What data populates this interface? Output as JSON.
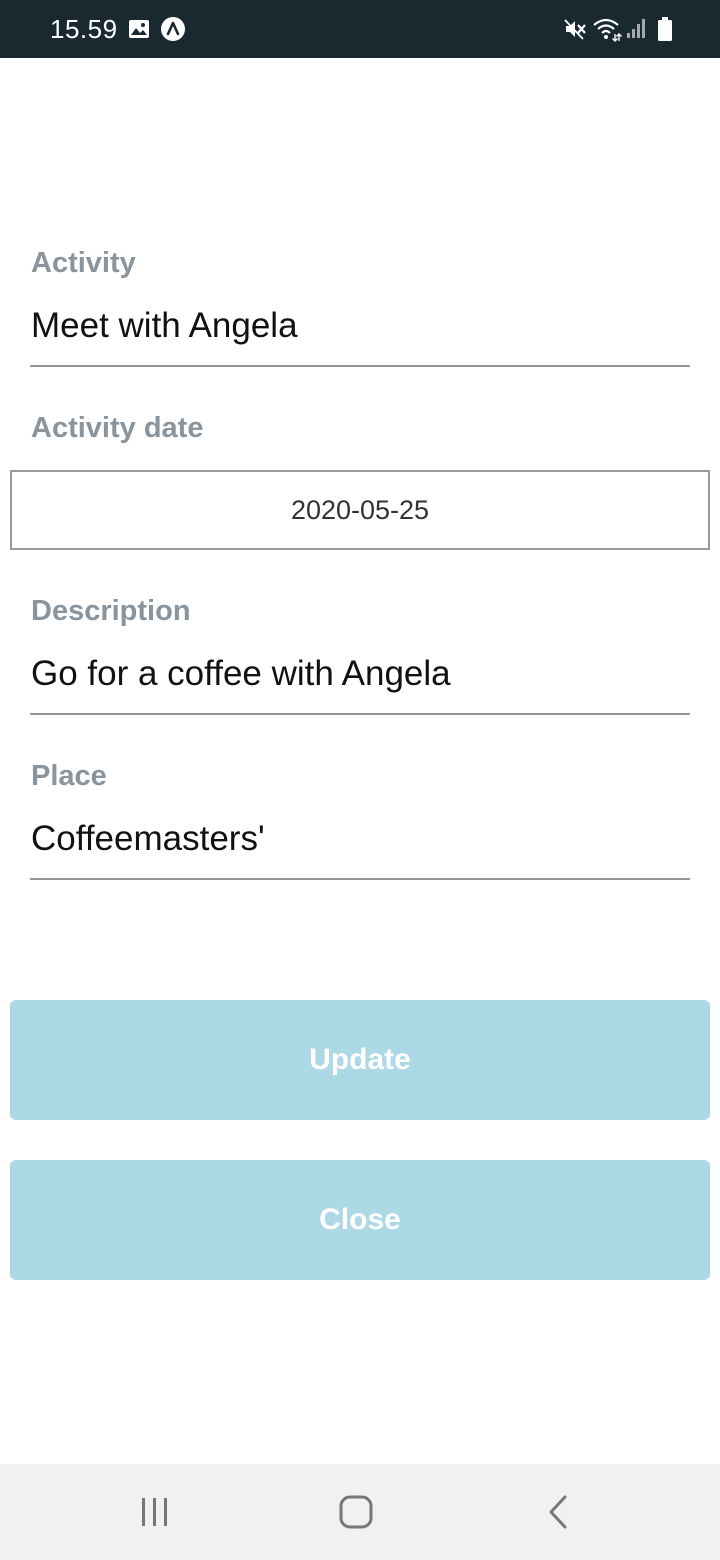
{
  "status_bar": {
    "time": "15.59",
    "icons": [
      "gallery-icon",
      "app-icon",
      "mute-icon",
      "wifi-icon",
      "signal-icon",
      "battery-icon"
    ]
  },
  "form": {
    "activity": {
      "label": "Activity",
      "value": "Meet with Angela"
    },
    "activity_date": {
      "label": "Activity date",
      "value": "2020-05-25"
    },
    "description": {
      "label": "Description",
      "value": "Go for a coffee with Angela"
    },
    "place": {
      "label": "Place",
      "value": "Coffeemasters'"
    }
  },
  "buttons": {
    "update": "Update",
    "close": "Close"
  },
  "nav_bar": {
    "icons": [
      "recent-apps-icon",
      "home-icon",
      "back-icon"
    ]
  },
  "colors": {
    "status_bar_bg": "#1a2930",
    "button_bg": "#add8e6",
    "label": "#8a949c",
    "underline": "#8f979c",
    "nav_bar_bg": "#f1f1f1"
  }
}
